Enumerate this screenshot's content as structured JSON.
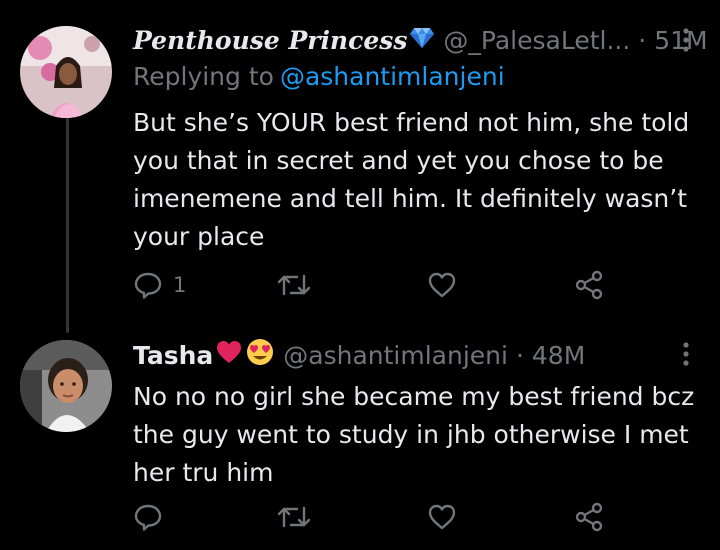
{
  "tweets": [
    {
      "display_name": "Penthouse Princess",
      "name_emoji_icon": "gem-icon",
      "handle": "@_PalesaLetl...",
      "separator": "·",
      "time": "51M",
      "replying_label": "Replying to",
      "replying_to": "@ashantimlanjeni",
      "text": "But she’s YOUR best friend not him, she told you that in secret and yet you chose to be imenemene and tell him. It definitely wasn’t your place",
      "reply_count": "1"
    },
    {
      "display_name": "Tasha",
      "name_emoji_icons": [
        "red-heart-icon",
        "heart-eyes-face-icon"
      ],
      "handle": "@ashantimlanjeni",
      "separator": "·",
      "time": "48M",
      "text": "No no no girl she became my best friend bcz the guy went to study in jhb otherwise I met her tru him",
      "reply_count": ""
    }
  ],
  "colors": {
    "background": "#000000",
    "primary_text": "#e7e9ea",
    "secondary_text": "#71767b",
    "link": "#1d9bf0",
    "thread_line": "#333639"
  }
}
